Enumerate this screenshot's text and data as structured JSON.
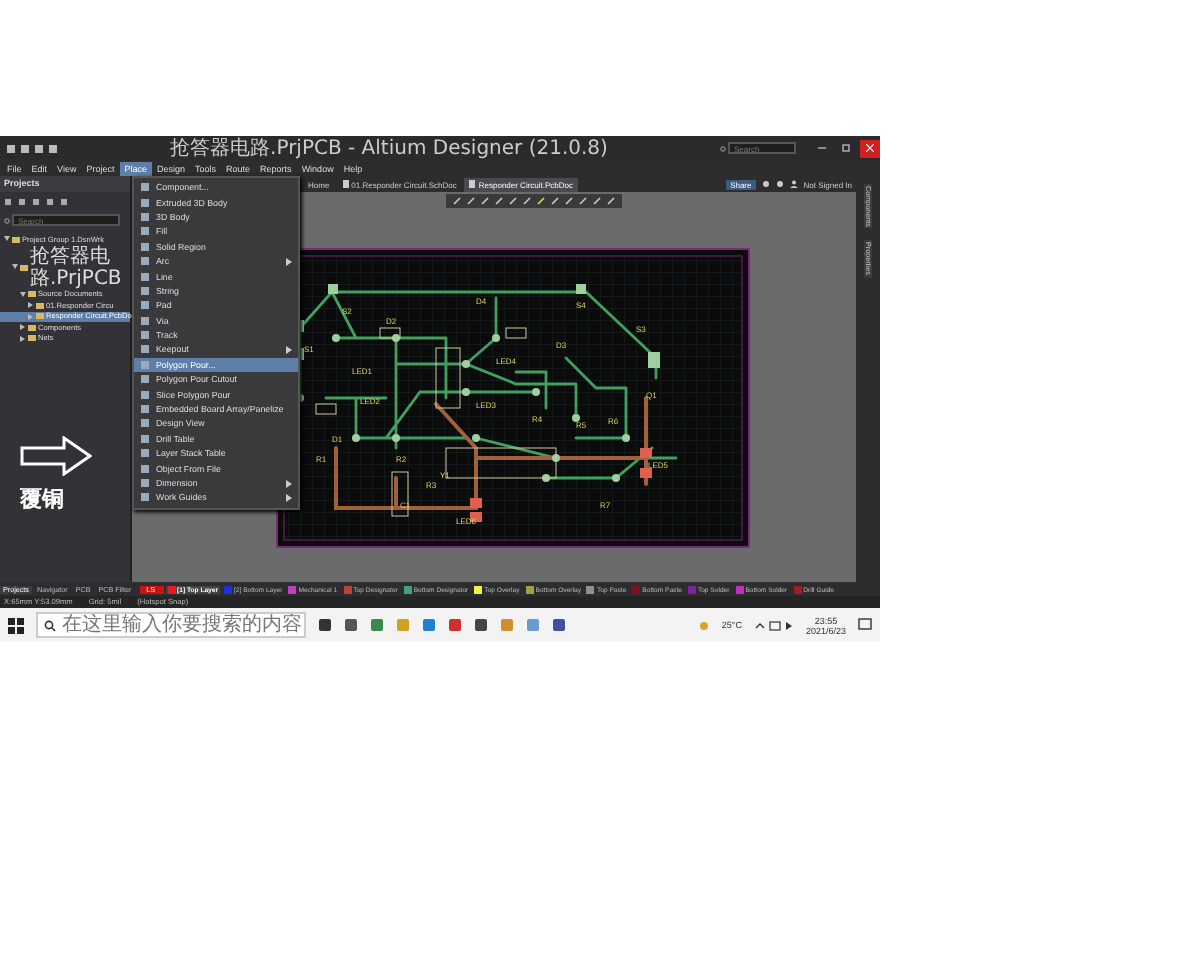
{
  "window": {
    "title": "抢答器电路.PrjPCB - Altium Designer (21.0.8)",
    "search_placeholder": "Search"
  },
  "menu_bar": [
    {
      "label": "File",
      "selected": false
    },
    {
      "label": "Edit",
      "selected": false
    },
    {
      "label": "View",
      "selected": false
    },
    {
      "label": "Project",
      "selected": false
    },
    {
      "label": "Place",
      "selected": true
    },
    {
      "label": "Design",
      "selected": false
    },
    {
      "label": "Tools",
      "selected": false
    },
    {
      "label": "Route",
      "selected": false
    },
    {
      "label": "Reports",
      "selected": false
    },
    {
      "label": "Window",
      "selected": false
    },
    {
      "label": "Help",
      "selected": false
    }
  ],
  "account_bar": {
    "share": "Share",
    "account": "Not Signed In"
  },
  "document_tabs": [
    {
      "label": "Home",
      "selected": false
    },
    {
      "label": "01.Responder Circuit.SchDoc",
      "selected": false
    },
    {
      "label": "Responder Circuit.PcbDoc",
      "selected": true
    }
  ],
  "projects_panel": {
    "title": "Projects",
    "search_placeholder": "Search",
    "tree": [
      {
        "label": "Project Group 1.DsnWrk",
        "selected": false,
        "children": [
          {
            "label": "抢答器电路.PrjPCB",
            "selected": false,
            "children": [
              {
                "label": "Source Documents",
                "selected": false,
                "children": [
                  {
                    "label": "01.Responder Circu",
                    "selected": false
                  },
                  {
                    "label": "Responder Circuit.PcbDo",
                    "selected": true
                  }
                ]
              },
              {
                "label": "Components",
                "selected": false
              },
              {
                "label": "Nets",
                "selected": false
              }
            ]
          }
        ]
      }
    ]
  },
  "place_menu": [
    {
      "label": "Component...",
      "kind": "item",
      "selected": false
    },
    {
      "label": "Extruded 3D Body",
      "kind": "item",
      "selected": false
    },
    {
      "label": "3D Body",
      "kind": "item",
      "selected": false
    },
    {
      "label": "Fill",
      "kind": "item",
      "selected": false
    },
    {
      "label": "Solid Region",
      "kind": "item",
      "selected": false
    },
    {
      "label": "Arc",
      "kind": "submenu",
      "selected": false
    },
    {
      "label": "Line",
      "kind": "item",
      "selected": false
    },
    {
      "label": "String",
      "kind": "item",
      "selected": false
    },
    {
      "label": "Pad",
      "kind": "item",
      "selected": false
    },
    {
      "label": "Via",
      "kind": "item",
      "selected": false
    },
    {
      "label": "Track",
      "kind": "item",
      "selected": false
    },
    {
      "label": "Keepout",
      "kind": "submenu",
      "selected": false
    },
    {
      "label": "Polygon Pour...",
      "kind": "item",
      "selected": true
    },
    {
      "label": "Polygon Pour Cutout",
      "kind": "item",
      "selected": false
    },
    {
      "label": "Slice Polygon Pour",
      "kind": "item",
      "selected": false
    },
    {
      "label": "Embedded Board Array/Panelize",
      "kind": "item",
      "selected": false
    },
    {
      "label": "Design View",
      "kind": "item",
      "selected": false
    },
    {
      "label": "Drill Table",
      "kind": "item",
      "selected": false
    },
    {
      "label": "Layer Stack Table",
      "kind": "item",
      "selected": false
    },
    {
      "label": "Object From File",
      "kind": "item",
      "selected": false
    },
    {
      "label": "Dimension",
      "kind": "submenu",
      "selected": false
    },
    {
      "label": "Work Guides",
      "kind": "submenu",
      "selected": false
    }
  ],
  "annotation": {
    "label": "覆铜"
  },
  "right_panel_tabs": [
    "Components",
    "Properties"
  ],
  "pcb": {
    "designators": [
      "S2",
      "D2",
      "S1",
      "LED1",
      "LED2",
      "D1",
      "R1",
      "R2",
      "C1",
      "R3",
      "D4",
      "LED4",
      "D3",
      "LED3",
      "R4",
      "R5",
      "R6",
      "S4",
      "S3",
      "Q1",
      "LED5",
      "R7",
      "LED6",
      "Y1"
    ]
  },
  "panel_tabs": [
    {
      "label": "Projects",
      "selected": true
    },
    {
      "label": "Navigator",
      "selected": false
    },
    {
      "label": "PCB",
      "selected": false
    },
    {
      "label": "PCB Filter",
      "selected": false
    }
  ],
  "layer_set": "LS",
  "layer_tabs": [
    {
      "label": "[1] Top Layer",
      "color": "#e02020",
      "selected": true
    },
    {
      "label": "[2] Bottom Layer",
      "color": "#2030e0",
      "selected": false
    },
    {
      "label": "Mechanical 1",
      "color": "#c040c0",
      "selected": false
    },
    {
      "label": "Top Designator",
      "color": "#c04040",
      "selected": false
    },
    {
      "label": "Bottom Designator",
      "color": "#40a080",
      "selected": false
    },
    {
      "label": "Top Overlay",
      "color": "#f0f040",
      "selected": false
    },
    {
      "label": "Bottom Overlay",
      "color": "#a0a040",
      "selected": false
    },
    {
      "label": "Top Paste",
      "color": "#909090",
      "selected": false
    },
    {
      "label": "Bottom Paste",
      "color": "#801020",
      "selected": false
    },
    {
      "label": "Top Solder",
      "color": "#8020a0",
      "selected": false
    },
    {
      "label": "Bottom Solder",
      "color": "#c030c0",
      "selected": false
    },
    {
      "label": "Drill Guide",
      "color": "#a02020",
      "selected": false
    }
  ],
  "status_bar": [
    "X:65mm Y:53.09mm",
    "Grid: 5mil",
    "(Hotspot Snap)"
  ],
  "taskbar": {
    "search_placeholder": "在这里输入你要搜索的内容",
    "weather": "25°C",
    "time": "23:55",
    "date": "2021/6/23"
  }
}
